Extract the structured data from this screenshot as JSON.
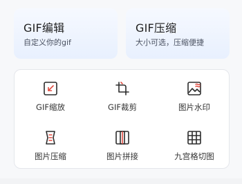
{
  "cards": [
    {
      "title": "GIF编辑",
      "subtitle": "自定义你的gif"
    },
    {
      "title": "GIF压缩",
      "subtitle": "大小可选，压缩便捷"
    }
  ],
  "tools": [
    {
      "label": "GIF缩放",
      "icon": "scale-icon"
    },
    {
      "label": "GIF裁剪",
      "icon": "crop-icon"
    },
    {
      "label": "图片水印",
      "icon": "watermark-icon"
    },
    {
      "label": "图片压缩",
      "icon": "compress-icon"
    },
    {
      "label": "图片拼接",
      "icon": "stitch-icon"
    },
    {
      "label": "九宫格切图",
      "icon": "grid-cut-icon"
    }
  ],
  "colors": {
    "accent_red": "#e04a3f",
    "icon_dark": "#2b2b2b",
    "card_bg": "#e8f0fe"
  }
}
